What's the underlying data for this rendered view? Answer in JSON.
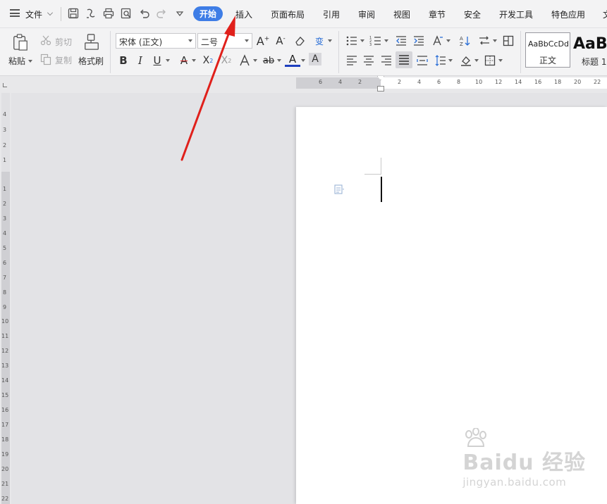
{
  "menubar": {
    "file_label": "文件",
    "tabs": [
      "开始",
      "插入",
      "页面布局",
      "引用",
      "审阅",
      "视图",
      "章节",
      "安全",
      "开发工具",
      "特色应用",
      "文"
    ]
  },
  "ribbon": {
    "paste_label": "粘贴",
    "cut_label": "剪切",
    "copy_label": "复制",
    "format_painter_label": "格式刷",
    "font_name": "宋体 (正文)",
    "font_size": "二号",
    "styles": [
      {
        "preview": "AaBbCcDd",
        "name": "正文"
      },
      {
        "preview": "AaB",
        "name": "标题 1"
      }
    ]
  },
  "ruler": {
    "h_numbers": [
      "6",
      "4",
      "2",
      "2",
      "4",
      "6",
      "8",
      "10",
      "12",
      "14",
      "16",
      "18",
      "20",
      "22"
    ],
    "v_numbers_top": [
      "4",
      "3",
      "2",
      "1"
    ],
    "v_numbers": [
      "1",
      "2",
      "3",
      "4",
      "5",
      "6",
      "7",
      "8",
      "9",
      "10",
      "11",
      "12",
      "13",
      "14",
      "15",
      "16",
      "17",
      "18",
      "19",
      "20",
      "21",
      "22"
    ]
  },
  "watermark": {
    "brand": "Baidu 经验",
    "url": "jingyan.baidu.com"
  },
  "colors": {
    "accent": "#3e7de6",
    "annotation_arrow": "#e0201b",
    "font_color_a": "#1e3fbf",
    "highlight_underline": "#e03030"
  }
}
